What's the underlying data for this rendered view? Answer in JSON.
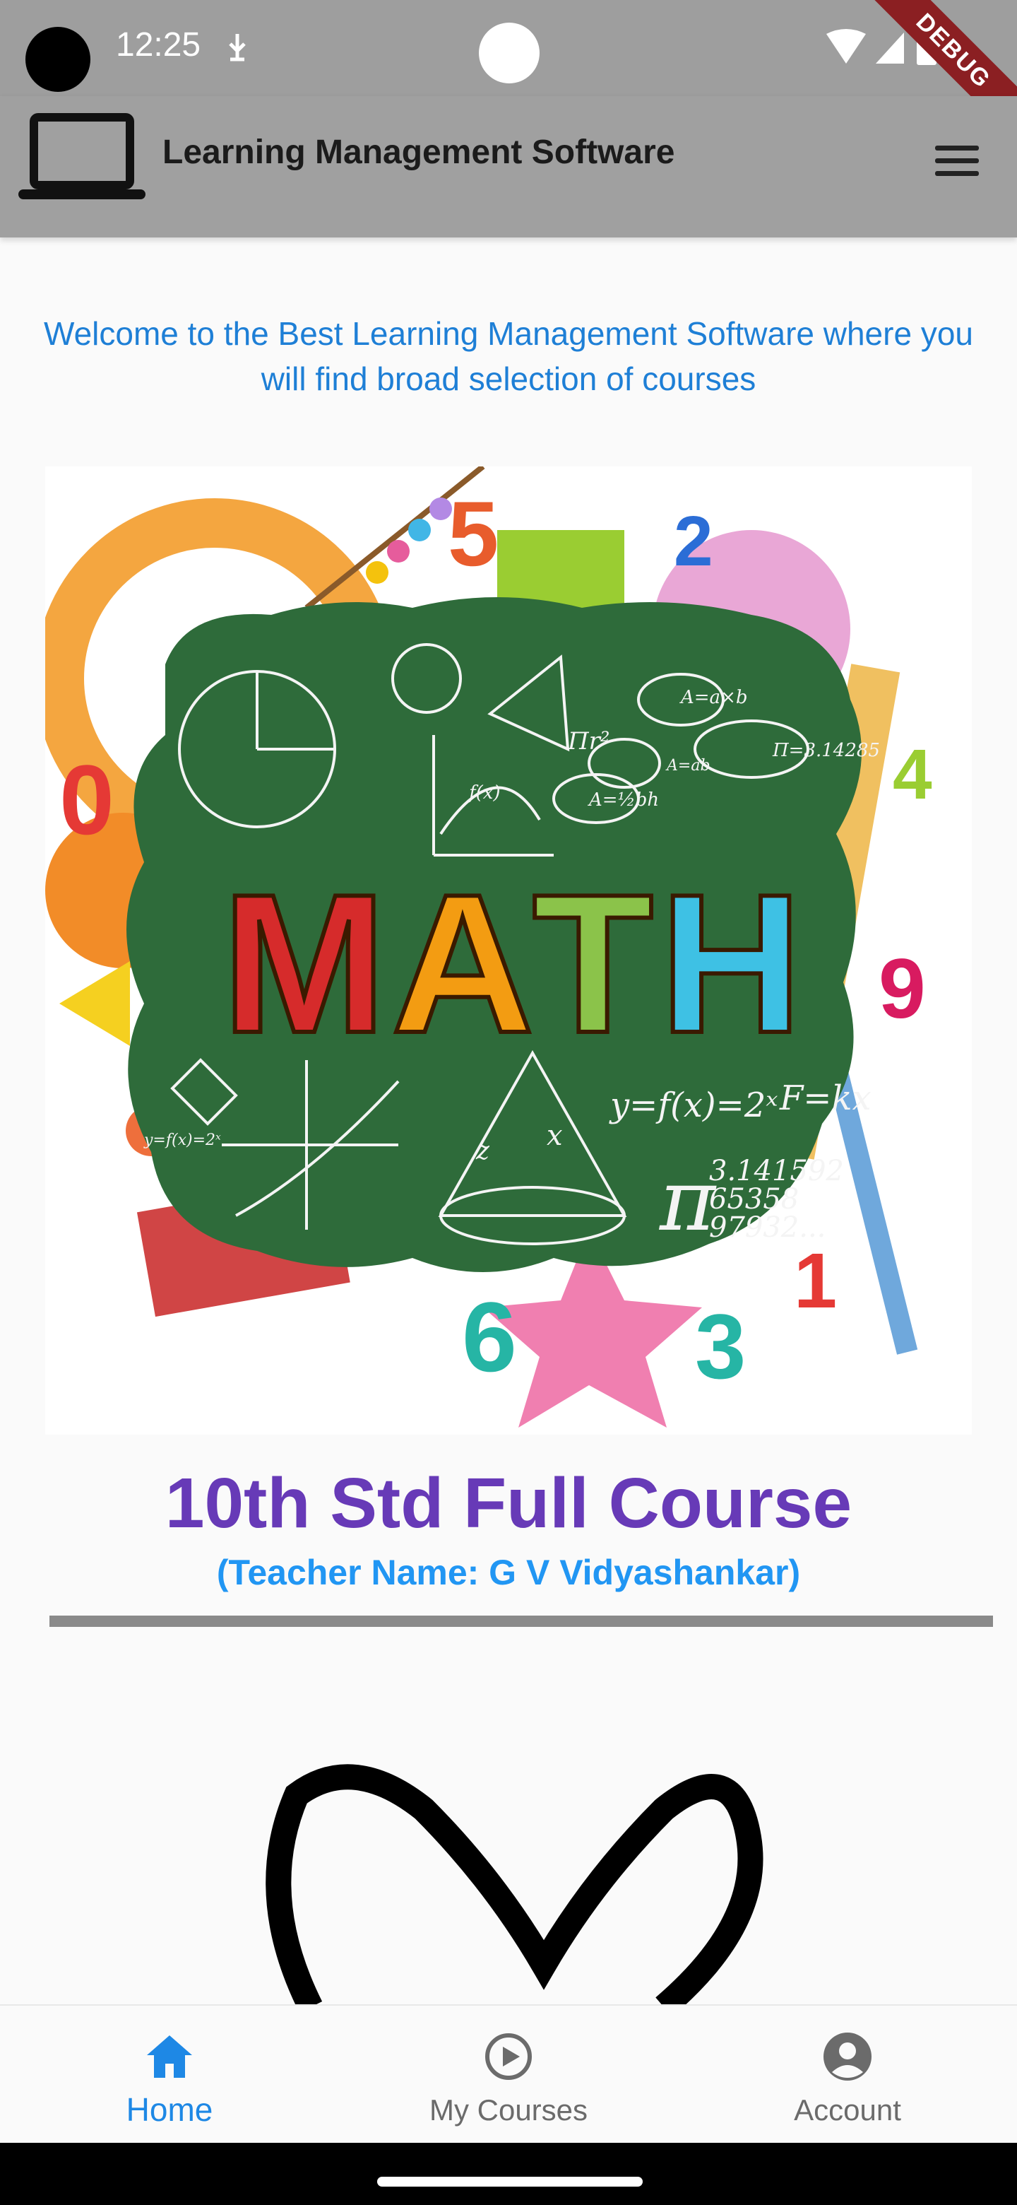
{
  "status_bar": {
    "time": "12:25",
    "debug_label": "DEBUG"
  },
  "app_bar": {
    "title": "Learning Management Software",
    "logo_icon": "laptop-icon",
    "menu_icon": "hamburger-menu-icon"
  },
  "welcome": {
    "text": "Welcome to the Best Learning Management Software where you will find broad selection of courses"
  },
  "courses": [
    {
      "title": "10th Std Full Course",
      "teacher": "(Teacher Name: G V Vidyashankar)",
      "image_word": "MATH",
      "image_formulas": [
        "Πr²",
        "A=a×b",
        "A=½bh",
        "A=ab",
        "Π=3.14285",
        "y=f(x)=2ˣ",
        "F=kx",
        "3.141592",
        "65358",
        "97932...",
        "f(x)",
        "y=f(x)=2ˣ"
      ],
      "image_numbers": [
        "5",
        "2",
        "0",
        "4",
        "9",
        "6",
        "3",
        "1"
      ]
    }
  ],
  "bottom_nav": {
    "items": [
      {
        "label": "Home",
        "icon": "home-icon",
        "active": true
      },
      {
        "label": "My Courses",
        "icon": "play-circle-icon",
        "active": false
      },
      {
        "label": "Account",
        "icon": "account-circle-icon",
        "active": false
      }
    ]
  },
  "colors": {
    "accent": "#2196f3",
    "course_title": "#673ab7",
    "app_bar": "#a0a0a0"
  }
}
